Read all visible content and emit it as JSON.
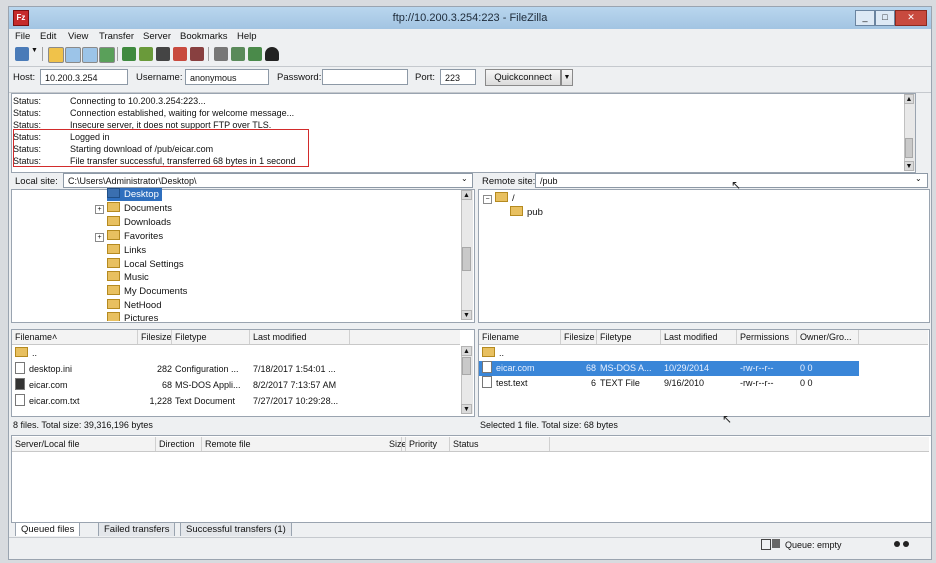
{
  "window": {
    "title": "ftp://10.200.3.254:223 - FileZilla",
    "app_icon": "Fz"
  },
  "menu": [
    "File",
    "Edit",
    "View",
    "Transfer",
    "Server",
    "Bookmarks",
    "Help"
  ],
  "quickconnect": {
    "host_label": "Host:",
    "host_value": "10.200.3.254",
    "username_label": "Username:",
    "username_value": "anonymous",
    "password_label": "Password:",
    "password_value": "",
    "port_label": "Port:",
    "port_value": "223",
    "button_label": "Quickconnect"
  },
  "log": [
    {
      "k": "Status:",
      "v": "Connecting to 10.200.3.254:223..."
    },
    {
      "k": "Status:",
      "v": "Connection established, waiting for welcome message..."
    },
    {
      "k": "Status:",
      "v": "Insecure server, it does not support FTP over TLS."
    },
    {
      "k": "Status:",
      "v": "Logged in"
    },
    {
      "k": "Status:",
      "v": "Starting download of /pub/eicar.com"
    },
    {
      "k": "Status:",
      "v": "File transfer successful, transferred 68 bytes in 1 second"
    }
  ],
  "local": {
    "site_label": "Local site:",
    "site_path": "C:\\Users\\Administrator\\Desktop\\",
    "tree": [
      "Desktop",
      "Documents",
      "Downloads",
      "Favorites",
      "Links",
      "Local Settings",
      "Music",
      "My Documents",
      "NetHood",
      "Pictures"
    ],
    "headers": [
      "Filename",
      "Filesize",
      "Filetype",
      "Last modified"
    ],
    "files": [
      {
        "name": "..",
        "size": "",
        "type": "",
        "modified": ""
      },
      {
        "name": "desktop.ini",
        "size": "282",
        "type": "Configuration ...",
        "modified": "7/18/2017 1:54:01 ..."
      },
      {
        "name": "eicar.com",
        "size": "68",
        "type": "MS-DOS Appli...",
        "modified": "8/2/2017 7:13:57 AM"
      },
      {
        "name": "eicar.com.txt",
        "size": "1,228",
        "type": "Text Document",
        "modified": "7/27/2017 10:29:28..."
      }
    ],
    "status": "8 files. Total size: 39,316,196 bytes"
  },
  "remote": {
    "site_label": "Remote site:",
    "site_path": "/pub",
    "tree": [
      "/",
      "pub"
    ],
    "headers": [
      "Filename",
      "Filesize",
      "Filetype",
      "Last modified",
      "Permissions",
      "Owner/Gro..."
    ],
    "files": [
      {
        "name": "..",
        "size": "",
        "type": "",
        "modified": "",
        "perm": "",
        "owner": ""
      },
      {
        "name": "eicar.com",
        "size": "68",
        "type": "MS-DOS A...",
        "modified": "10/29/2014",
        "perm": "-rw-r--r--",
        "owner": "0 0"
      },
      {
        "name": "test.text",
        "size": "6",
        "type": "TEXT File",
        "modified": "9/16/2010",
        "perm": "-rw-r--r--",
        "owner": "0 0"
      }
    ],
    "status": "Selected 1 file. Total size: 68 bytes"
  },
  "queue": {
    "headers": [
      "Server/Local file",
      "Direction",
      "Remote file",
      "Size",
      "Priority",
      "Status"
    ],
    "tabs": [
      "Queued files",
      "Failed transfers",
      "Successful transfers (1)"
    ],
    "status_text": "Queue: empty"
  },
  "colors": {
    "accent": "#3a86d8",
    "highlight_box": "#d22b2b",
    "titlebar": "#a2c4e2"
  }
}
